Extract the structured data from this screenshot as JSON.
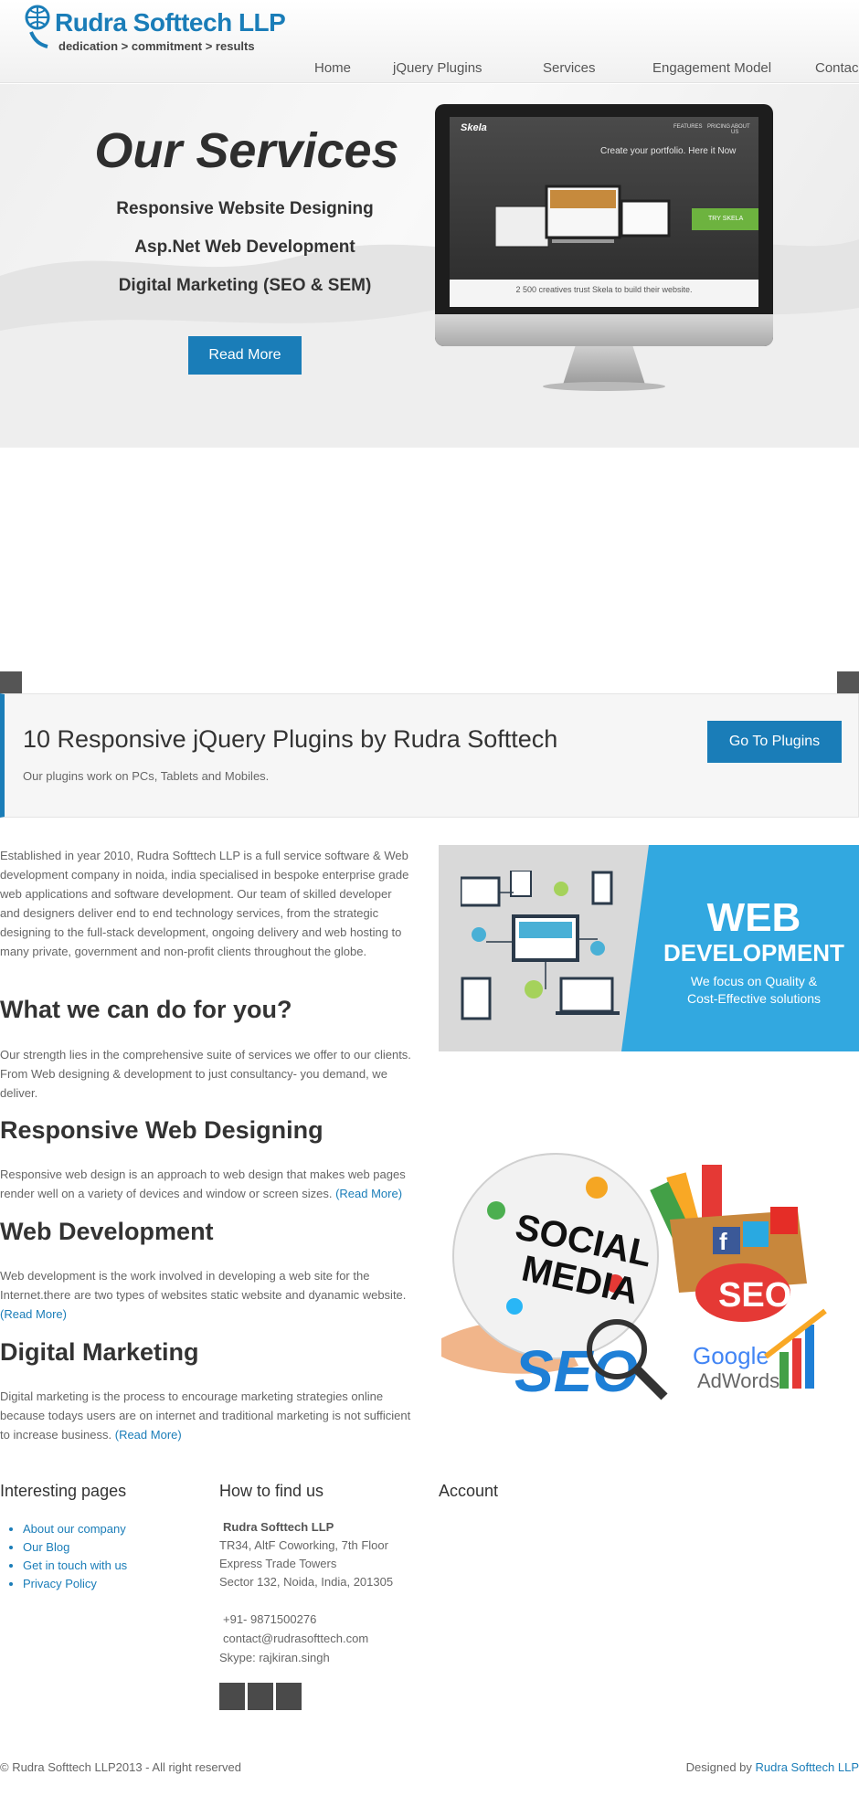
{
  "brand": {
    "name": "Rudra Softtech LLP",
    "tagline": "dedication > commitment > results"
  },
  "nav": [
    "Home",
    "jQuery Plugins",
    "Services",
    "Engagement Model",
    "Contac"
  ],
  "hero": {
    "title": "Our Services",
    "lines": [
      "Responsive Website Designing",
      "Asp.Net Web Development",
      "Digital Marketing (SEO & SEM)"
    ],
    "button": "Read More",
    "screen": {
      "logo": "Skela",
      "nav": [
        "FEATURES",
        "PRICING",
        "ABOUT US"
      ],
      "cta": "Create your portfolio. Here it Now",
      "button": "TRY SKELA",
      "bottom": "2 500 creatives trust Skela to build their website."
    }
  },
  "plugins": {
    "title": "10 Responsive jQuery Plugins by Rudra Softtech",
    "subtitle": "Our plugins work on PCs, Tablets and Mobiles.",
    "button": "Go To Plugins"
  },
  "intro": "Established in year 2010, Rudra Softtech LLP is a full service software & Web development company in noida, india specialised in bespoke enterprise grade web applications and software development. Our team of skilled developer and designers deliver end to end technology services, from the strategic designing to the full-stack development, ongoing delivery and web hosting to many private, government and non-profit clients throughout the globe.",
  "sections": [
    {
      "title": "What we can do for you?",
      "text": "Our strength lies in the comprehensive suite of services we offer to our clients. From Web designing & development to just consultancy- you demand, we deliver.",
      "more": ""
    },
    {
      "title": "Responsive Web Designing",
      "text": "Responsive web design is an approach to web design that makes web pages render well on a variety of devices and window or screen sizes. ",
      "more": "(Read More)"
    },
    {
      "title": "Web Development",
      "text": "Web development is the work involved in developing a web site for the Internet.there are two types of websites static website and dyanamic website. ",
      "more": "(Read More)"
    },
    {
      "title": "Digital Marketing",
      "text": "Digital marketing is the process to encourage marketing strategies online because todays users are on internet and traditional marketing is not sufficient to increase business. ",
      "more": "(Read More)"
    }
  ],
  "webdev_banner": {
    "title1": "WEB",
    "title2": "DEVELOPMENT",
    "sub1": "We focus on Quality &",
    "sub2": "Cost-Effective solutions"
  },
  "social_image": {
    "social": "SOCIAL",
    "media": "MEDIA",
    "seo": "SEO",
    "google": "Google",
    "adwords": "AdWords"
  },
  "footer": {
    "col1_title": "Interesting pages",
    "links": [
      "About our company",
      "Our Blog",
      "Get in touch with us",
      "Privacy Policy"
    ],
    "col2_title": "How to find us",
    "company": "Rudra Softtech LLP",
    "address": [
      "TR34, AltF Coworking, 7th Floor",
      "Express Trade Towers",
      "Sector 132, Noida, India, 201305"
    ],
    "phone": "+91- 9871500276",
    "email": "contact@rudrasofttech.com",
    "skype": "Skype: rajkiran.singh",
    "col3_title": "Account",
    "copyright": "© Rudra Softtech LLP2013 - All right reserved",
    "designed_prefix": "Designed by ",
    "designed_link": "Rudra Softtech LLP"
  },
  "colors": {
    "accent": "#1a7db8",
    "slider_arrow": "#555555",
    "webdev_blue": "#32a8e0"
  }
}
